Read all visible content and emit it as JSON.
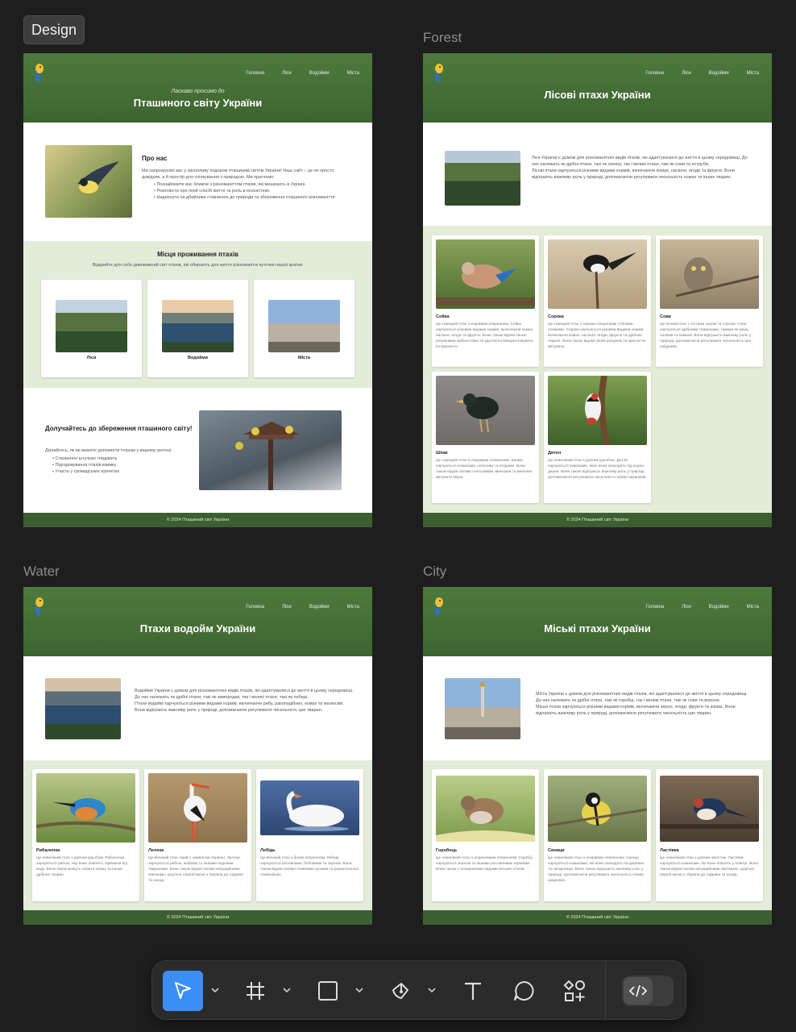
{
  "mode_label": "Design",
  "frame_labels": {
    "forest": "Forest",
    "water": "Water",
    "city": "City"
  },
  "nav": [
    "Головна",
    "Ліси",
    "Водойми",
    "Міста"
  ],
  "footer": "© 2024 Пташиний світ України",
  "home": {
    "welcome": "Ласкаво просимо до",
    "title": "Пташиного світу України",
    "about_title": "Про нас",
    "about_text": "Ми запрошуємо вас у захопливу подорож пташиним світом України! Наш сайт – це не просто довідник, а й простір для спілкування з природою. Ми прагнемо:",
    "about_list": [
      "Познайомити вас ближче з різноманіттям птахів, які мешкають в Україні.",
      "Розповісти про їхній спосіб життя та роль в екосистемі.",
      "Надихнути на дбайливе ставлення до природи та збереження пташиного різноманіття"
    ],
    "habitats_title": "Місця проживання птахів",
    "habitats_sub": "Відкрийте для себе дивовижний світ птахів, які обирають для життя різноманітні куточки нашої країни:",
    "habitats": [
      "Ліси",
      "Водойми",
      "Міста"
    ],
    "join_title": "Долучайтесь до збереження пташиного світу!",
    "join_text": "Дізнайтесь, як ви можете допомогти птахам у вашому регіоні:",
    "join_list": [
      "Створення штучних гніздівель",
      "Підгодовування птахів взимку",
      "Участь у громадських проектах"
    ]
  },
  "forest": {
    "title": "Лісові птахи України",
    "intro": "Ліси України є домом для різноманітних видів птахів, які адаптувалися до життя в цьому середовищі. До них належать як дрібні птахи, такі як синиці, так і великі птахи, такі як сови та яструби.\nЛісові птахи харчуються різними видами кормів, включаючи комах, насіння, ягоди та фрукти. Вони відіграють важливу роль у природі, допомагаючи регулювати чисельність комах та інших тварин.",
    "birds": [
      {
        "name": "Сойка",
        "desc": "Це середній птах з яскравим оперенням. Сойки харчуються різними видами кормів, включаючи комах, насіння, ягоди та фрукти. Вони також відомі своєю розумними здібностями та здатністю використовувати інструменти."
      },
      {
        "name": "Сорока",
        "desc": "Це середній птах з чорним оперенням з білими плямами. Сороки харчуються різними видами кормів, включаючи комах, насіння, ягоди, фрукти та дрібних тварин. Вони також відомі своїм розумом та здатністю імітувати."
      },
      {
        "name": "Сова",
        "desc": "Це нічний птах з гострим зором та слухом. Сови харчуються дрібними тваринами, такими як миші, полівки та комахи. Вони відіграють важливу роль у природі, допомагаючи регулювати чисельність цих шкідників."
      },
      {
        "name": "Шпак",
        "desc": "Це середній птах із яскравим оперенням. Шпаки харчуються комахами, насінням та ягодами. Вони також відомі своїми голосовими звичками та вмінням імітувати звуки."
      },
      {
        "name": "Дятел",
        "desc": "Це невеликий птах з довгим дзьобом. Дятли харчуються комахами, яких вони знаходять під корою дерев. Вони також відіграють важливу роль у природі, допомагаючи регулювати чисельність комах-шкідників."
      }
    ]
  },
  "water": {
    "title": "Птахи водойм України",
    "intro": "Водойми України є домом для різноманітних видів птахів, які адаптувалися до життя в цьому середовищі. До них належать як дрібні птахи, такі як зимородки, так і великі птахи, такі як лебеді.\nПтахи водойм харчуються різними видами кормів, включаючи рибу, ракоподібних, комах та молюсків. Вони відіграють важливу роль у природі, допомагаючи регулювати чисельність цих тварин.",
    "birds": [
      {
        "name": "Рибалочка",
        "desc": "Це невеликий птах з довгим дзьобом. Рибалочки харчуються рибою, яку вони ловлять, пірнаючи під воду. Вони також можуть ловити комах та інших дрібних тварин."
      },
      {
        "name": "Лелека",
        "desc": "Це великий птах, який є символом України. Лелеки харчуються рибою, жабами та іншими водними тваринами. Вони також відомі своїми міграційними звичками, щорічно перелітаючи з України до Африки та назад."
      },
      {
        "name": "Лебідь",
        "desc": "Це великий птах з білим оперенням. Лебеді харчуються рослинами, бобовими та зерном. Вони також відомі своїми плавними рухами та романтичною символікою."
      }
    ]
  },
  "city": {
    "title": "Міські птахи України",
    "intro": "Міста України є домом для різноманітних видів птахів, які адаптувалися до життя в цьому середовищі. До них належать як дрібні птахи, такі як горобці, так і великі птахи, такі як сови та ворони.\nМіські птахи харчуються різними видами кормів, включаючи зерно, ягоди, фрукти та комах. Вони відіграють важливу роль у природі, допомагаючи регулювати чисельність цих тварин.",
    "birds": [
      {
        "name": "Горобець",
        "desc": "Це невеликий птах із коричневим оперенням. Горобці харчуються зерном та іншими рослинними кормами. Вони також є поширеними видами міських птахів."
      },
      {
        "name": "Синиця",
        "desc": "Це невеликий птах із яскравим оперенням. Синиці харчуються комахами, які вони знаходять на деревах та чагарниках. Вони також відіграють важливу роль у природі, допомагаючи регулювати чисельність комах-шкідників."
      },
      {
        "name": "Ластівка",
        "desc": "Це невеликий птах з довгим хвостом. Ластівки харчуються комахами, які вони ловлять у повітрі. Вони також відомі своїми міграційними звичками, щорічно перелітаючи з України до Африки та назад."
      }
    ]
  },
  "toolbar": {
    "tools": [
      "move-tool",
      "frame-tool",
      "shape-tool",
      "pen-tool",
      "text-tool",
      "comment-tool",
      "actions-tool"
    ],
    "active_color": "#3a8ef6"
  }
}
